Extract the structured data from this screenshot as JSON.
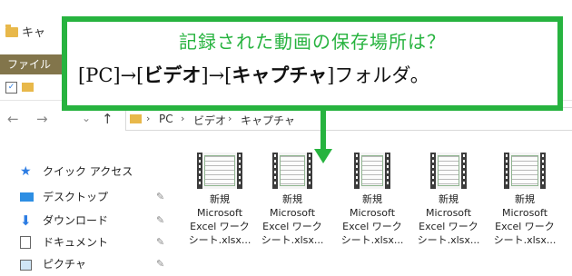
{
  "window": {
    "title": "キャ"
  },
  "ribbon": {
    "file_tab": "ファイル"
  },
  "address": {
    "crumbs": [
      "PC",
      "ビデオ",
      "キャプチャ"
    ],
    "separator": "›"
  },
  "nav": {
    "back": "←",
    "forward": "→",
    "recent": "⌄",
    "up": "↑",
    "items": [
      {
        "label": "クイック アクセス",
        "icon": "star-icon"
      },
      {
        "label": "デスクトップ",
        "icon": "desktop-icon"
      },
      {
        "label": "ダウンロード",
        "icon": "download-icon"
      },
      {
        "label": "ドキュメント",
        "icon": "document-icon"
      },
      {
        "label": "ピクチャ",
        "icon": "pictures-icon"
      }
    ]
  },
  "files": [
    {
      "line1": "新規",
      "line2": "Microsoft",
      "line3": "Excel ワーク",
      "line4": "シート.xlsx..."
    },
    {
      "line1": "新規",
      "line2": "Microsoft",
      "line3": "Excel ワーク",
      "line4": "シート.xlsx..."
    },
    {
      "line1": "新規",
      "line2": "Microsoft",
      "line3": "Excel ワーク",
      "line4": "シート.xlsx..."
    },
    {
      "line1": "新規",
      "line2": "Microsoft",
      "line3": "Excel ワーク",
      "line4": "シート.xlsx..."
    },
    {
      "line1": "新規",
      "line2": "Microsoft",
      "line3": "Excel ワーク",
      "line4": "シート.xlsx..."
    }
  ],
  "callout": {
    "heading": "記録された動画の保存場所は？",
    "b1": "[PC]→[",
    "b2": "ビデオ",
    "b3": "]→[",
    "b4": "キャプチャ",
    "b5": "]フォルダ。"
  },
  "colors": {
    "accent": "#27b33f",
    "file_tab": "#82754b",
    "folder": "#e8b84a"
  }
}
